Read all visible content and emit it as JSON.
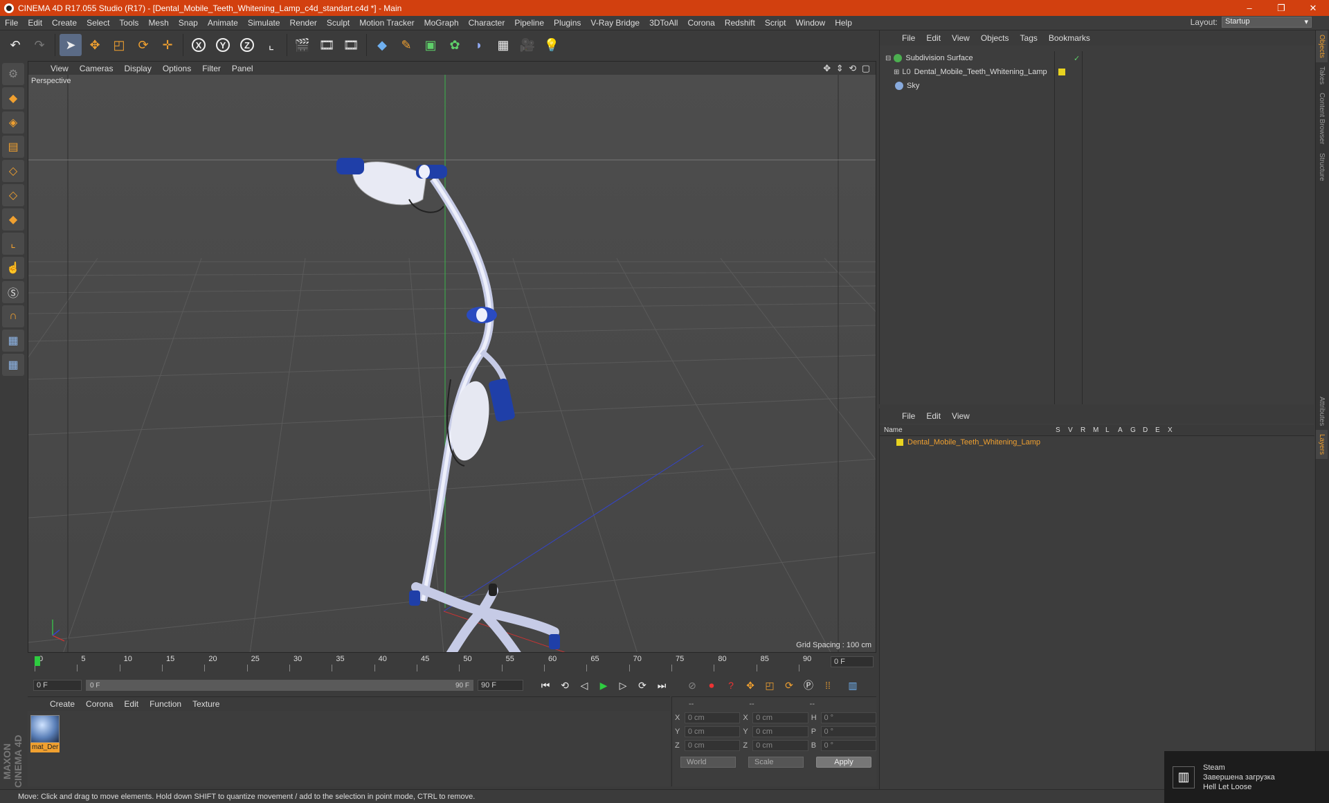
{
  "window": {
    "title": "CINEMA 4D R17.055 Studio (R17) - [Dental_Mobile_Teeth_Whitening_Lamp_c4d_standart.c4d *] - Main",
    "controls": [
      "–",
      "❐",
      "✕"
    ]
  },
  "menubar": [
    "File",
    "Edit",
    "Create",
    "Select",
    "Tools",
    "Mesh",
    "Snap",
    "Animate",
    "Simulate",
    "Render",
    "Sculpt",
    "Motion Tracker",
    "MoGraph",
    "Character",
    "Pipeline",
    "Plugins",
    "V-Ray Bridge",
    "3DToAll",
    "Corona",
    "Redshift",
    "Script",
    "Window",
    "Help"
  ],
  "layout": {
    "label": "Layout:",
    "value": "Startup"
  },
  "viewport": {
    "menu": [
      "View",
      "Cameras",
      "Display",
      "Options",
      "Filter",
      "Panel"
    ],
    "label": "Perspective",
    "grid_spacing": "Grid Spacing : 100 cm",
    "nav_icons": "✥ ⇕ ⟲ ▢"
  },
  "timeline": {
    "ticks": [
      "0",
      "5",
      "10",
      "15",
      "20",
      "25",
      "30",
      "35",
      "40",
      "45",
      "50",
      "55",
      "60",
      "65",
      "70",
      "75",
      "80",
      "85",
      "90"
    ],
    "current_frame": "0 F",
    "start_field": "0 F",
    "range_start": "0 F",
    "range_end": "90 F",
    "end_field": "90 F"
  },
  "material_panel": {
    "menu": [
      "Create",
      "Corona",
      "Edit",
      "Function",
      "Texture"
    ],
    "material_label": "mat_Der"
  },
  "coords": {
    "headers": [
      "--",
      "--",
      "--"
    ],
    "rows": [
      {
        "a": "X",
        "v1": "0 cm",
        "b": "X",
        "v2": "0 cm",
        "c": "H",
        "v3": "0 °"
      },
      {
        "a": "Y",
        "v1": "0 cm",
        "b": "Y",
        "v2": "0 cm",
        "c": "P",
        "v3": "0 °"
      },
      {
        "a": "Z",
        "v1": "0 cm",
        "b": "Z",
        "v2": "0 cm",
        "c": "B",
        "v3": "0 °"
      }
    ],
    "space": "World",
    "mode": "Scale",
    "apply": "Apply"
  },
  "status": "Move: Click and drag to move elements. Hold down SHIFT to quantize movement / add to the selection in point mode, CTRL to remove.",
  "objects_panel": {
    "menu": [
      "File",
      "Edit",
      "View",
      "Objects",
      "Tags",
      "Bookmarks"
    ],
    "items": [
      {
        "name": "Subdivision Surface",
        "color": "#4caf50"
      },
      {
        "name": "Dental_Mobile_Teeth_Whitening_Lamp",
        "color": "#aaaaaa"
      },
      {
        "name": "Sky",
        "color": "#88aadd"
      }
    ]
  },
  "layers_panel": {
    "menu": [
      "File",
      "Edit",
      "View"
    ],
    "columns": [
      "Name",
      "S",
      "V",
      "R",
      "M",
      "L",
      "A",
      "G",
      "D",
      "E",
      "X"
    ],
    "layer": "Dental_Mobile_Teeth_Whitening_Lamp"
  },
  "side_tabs": [
    "Objects",
    "Takes",
    "Content Browser",
    "Structure",
    "Attributes",
    "Layers"
  ],
  "brand": "MAXON CINEMA 4D",
  "steam": {
    "title": "Steam",
    "line1": "Завершена загрузка",
    "line2": "Hell Let Loose"
  },
  "colors": {
    "title_bar": "#d2400f",
    "accent": "#f0a030",
    "lamp_blue": "#1f3fa8"
  }
}
